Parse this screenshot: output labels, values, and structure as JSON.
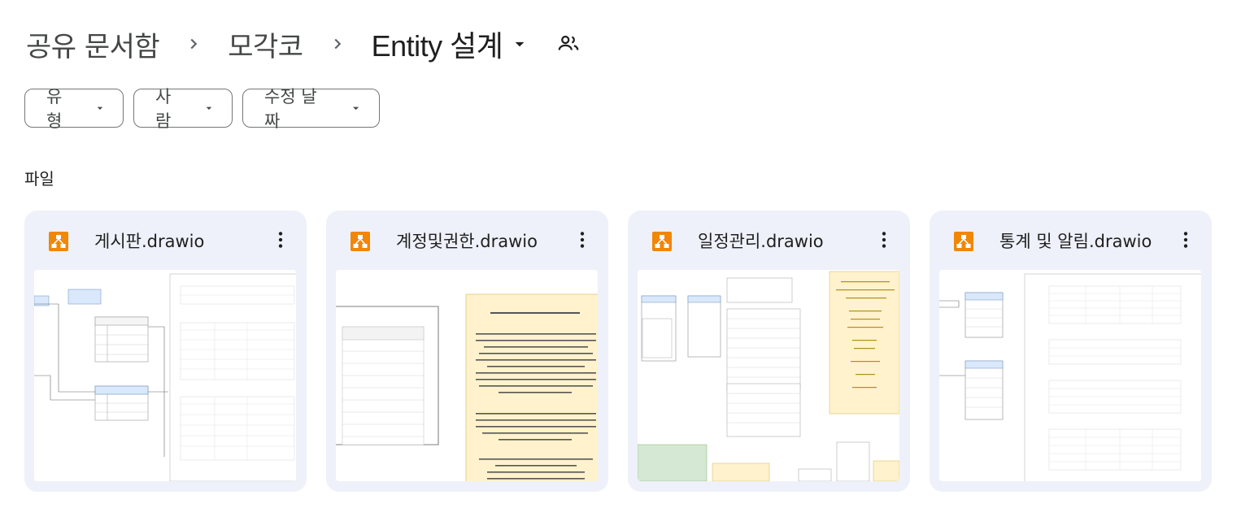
{
  "breadcrumb": {
    "items": [
      "공유 문서함",
      "모각코"
    ],
    "current": "Entity 설계"
  },
  "filters": [
    {
      "label": "유형"
    },
    {
      "label": "사람"
    },
    {
      "label": "수정 날짜"
    }
  ],
  "section_label": "파일",
  "files": [
    {
      "name": "게시판.drawio",
      "icon": "drawio-icon"
    },
    {
      "name": "계정및권한.drawio",
      "icon": "drawio-icon"
    },
    {
      "name": "일정관리.drawio",
      "icon": "drawio-icon"
    },
    {
      "name": "통계 및 알림.drawio",
      "icon": "drawio-icon"
    }
  ],
  "colors": {
    "card_bg": "#eef1f9",
    "drawio_orange": "#f08705",
    "chip_border": "#747775"
  }
}
